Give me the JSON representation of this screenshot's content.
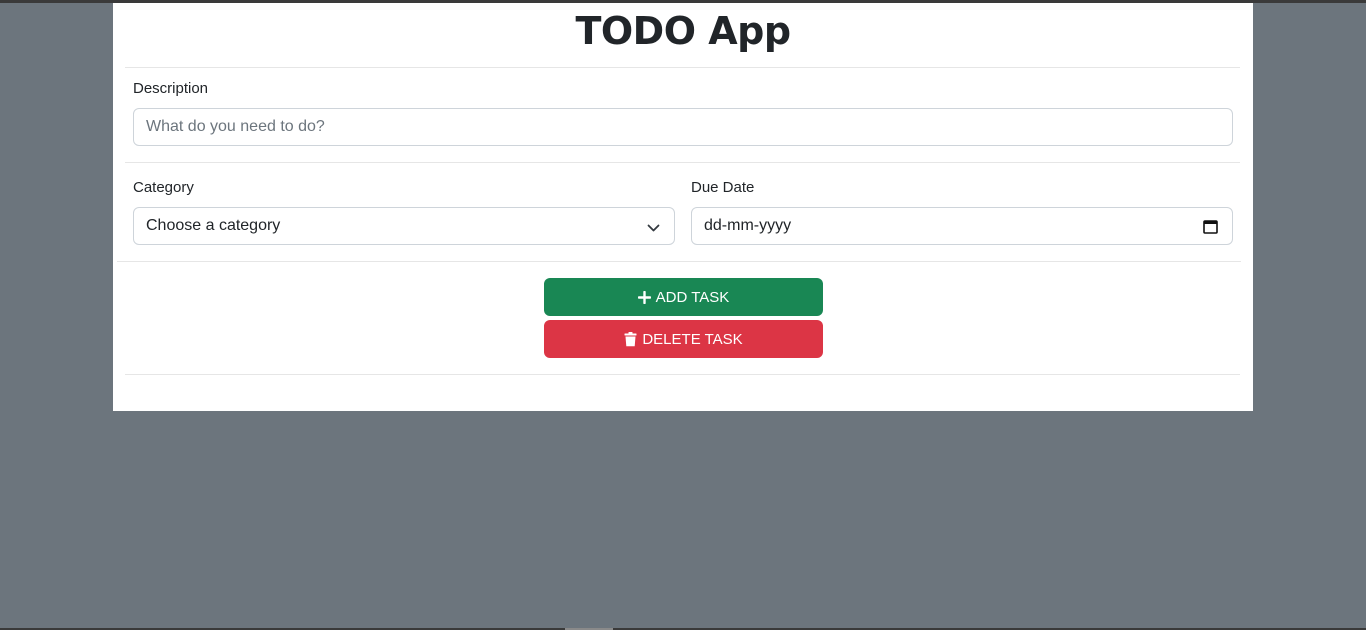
{
  "app": {
    "title": "TODO App"
  },
  "form": {
    "description": {
      "label": "Description",
      "placeholder": "What do you need to do?"
    },
    "category": {
      "label": "Category",
      "selected": "Choose a category"
    },
    "due_date": {
      "label": "Due Date",
      "value": "dd-mm-yyyy"
    }
  },
  "actions": {
    "add_label": "ADD TASK",
    "delete_label": "DELETE TASK"
  },
  "colors": {
    "add": "#198754",
    "delete": "#dc3545",
    "background": "#6c757d"
  },
  "icons": {
    "add": "plus-icon",
    "delete": "trash-icon",
    "select": "chevron-down-icon",
    "date": "calendar-icon"
  }
}
